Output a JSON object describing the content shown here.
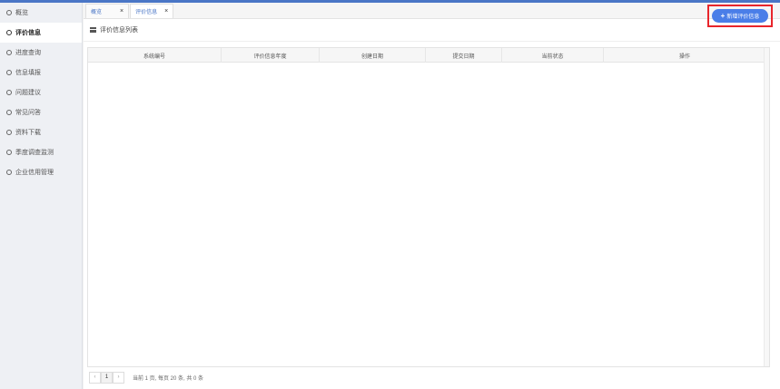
{
  "sidebar": {
    "items": [
      {
        "label": "概览",
        "active": false
      },
      {
        "label": "评价信息",
        "active": true
      },
      {
        "label": "进度查询",
        "active": false
      },
      {
        "label": "信息填报",
        "active": false
      },
      {
        "label": "问题建议",
        "active": false
      },
      {
        "label": "常见问答",
        "active": false
      },
      {
        "label": "资料下载",
        "active": false
      },
      {
        "label": "季度调查监测",
        "active": false
      },
      {
        "label": "企业信用管理",
        "active": false
      }
    ]
  },
  "tabs": [
    {
      "label": "概览",
      "close": "×"
    },
    {
      "label": "评价信息",
      "close": "×"
    }
  ],
  "toolbar": {
    "title": "评价信息列表",
    "add_button_label": "新增评价信息",
    "add_button_icon": "plus-icon"
  },
  "table": {
    "columns": [
      "系统编号",
      "评价信息年度",
      "创建日期",
      "提交日期",
      "当前状态",
      "操作"
    ],
    "rows": []
  },
  "pagination": {
    "prev": "‹",
    "current_page": "1",
    "next": "›",
    "info": "当前 1 页, 每页 20 条, 共 0 条"
  },
  "colors": {
    "accent": "#4a7ee8",
    "highlight_border": "#e8252b"
  }
}
